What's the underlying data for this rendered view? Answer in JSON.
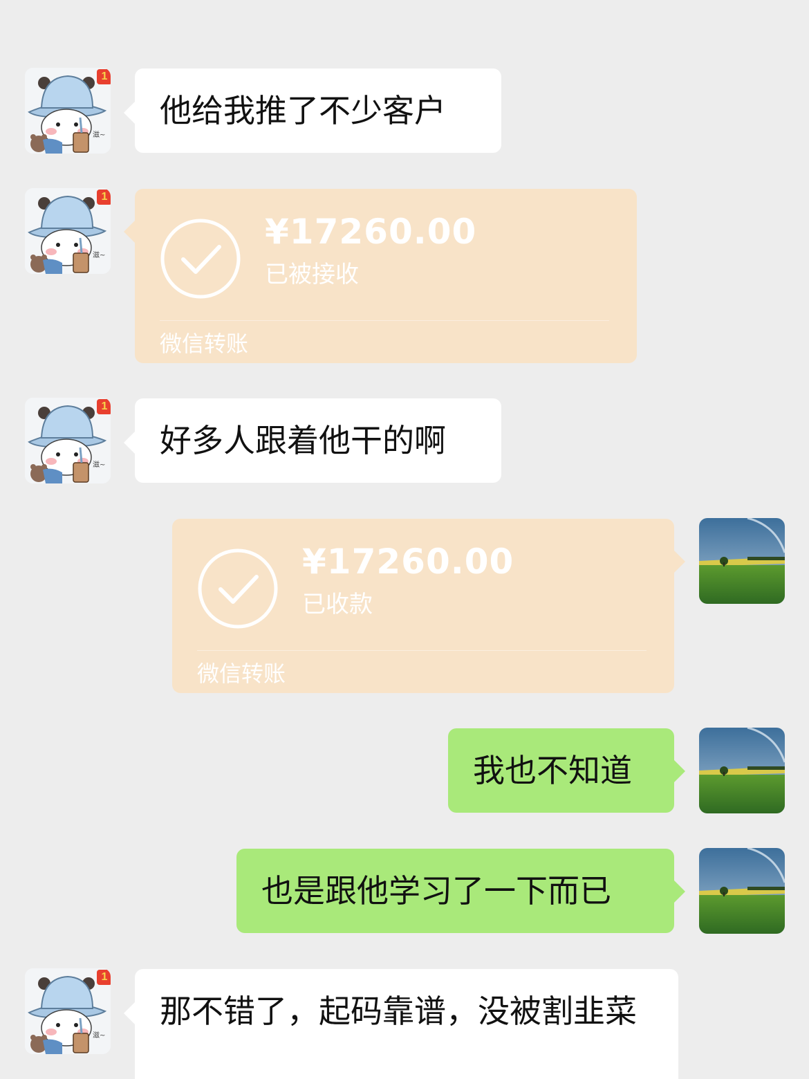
{
  "messages": [
    {
      "text": "他给我推了不少客户"
    },
    {
      "amount": "¥17260.00",
      "status": "已被接收",
      "label": "微信转账"
    },
    {
      "text": "好多人跟着他干的啊"
    },
    {
      "amount": "¥17260.00",
      "status": "已收款",
      "label": "微信转账"
    },
    {
      "text": "我也不知道"
    },
    {
      "text": "也是跟他学习了一下而已"
    },
    {
      "text": "那不错了，起码靠谱，没被割韭菜"
    }
  ],
  "badge_count": "1",
  "colors": {
    "background": "#ededed",
    "incoming_bubble": "#ffffff",
    "outgoing_bubble": "#a9e97a",
    "transfer_card": "#f8e3c8"
  },
  "icons": {
    "contact_avatar": "cartoon-bear-with-hat-avatar",
    "self_avatar": "green-field-rainbow-avatar",
    "transfer": "check-circle-icon"
  }
}
